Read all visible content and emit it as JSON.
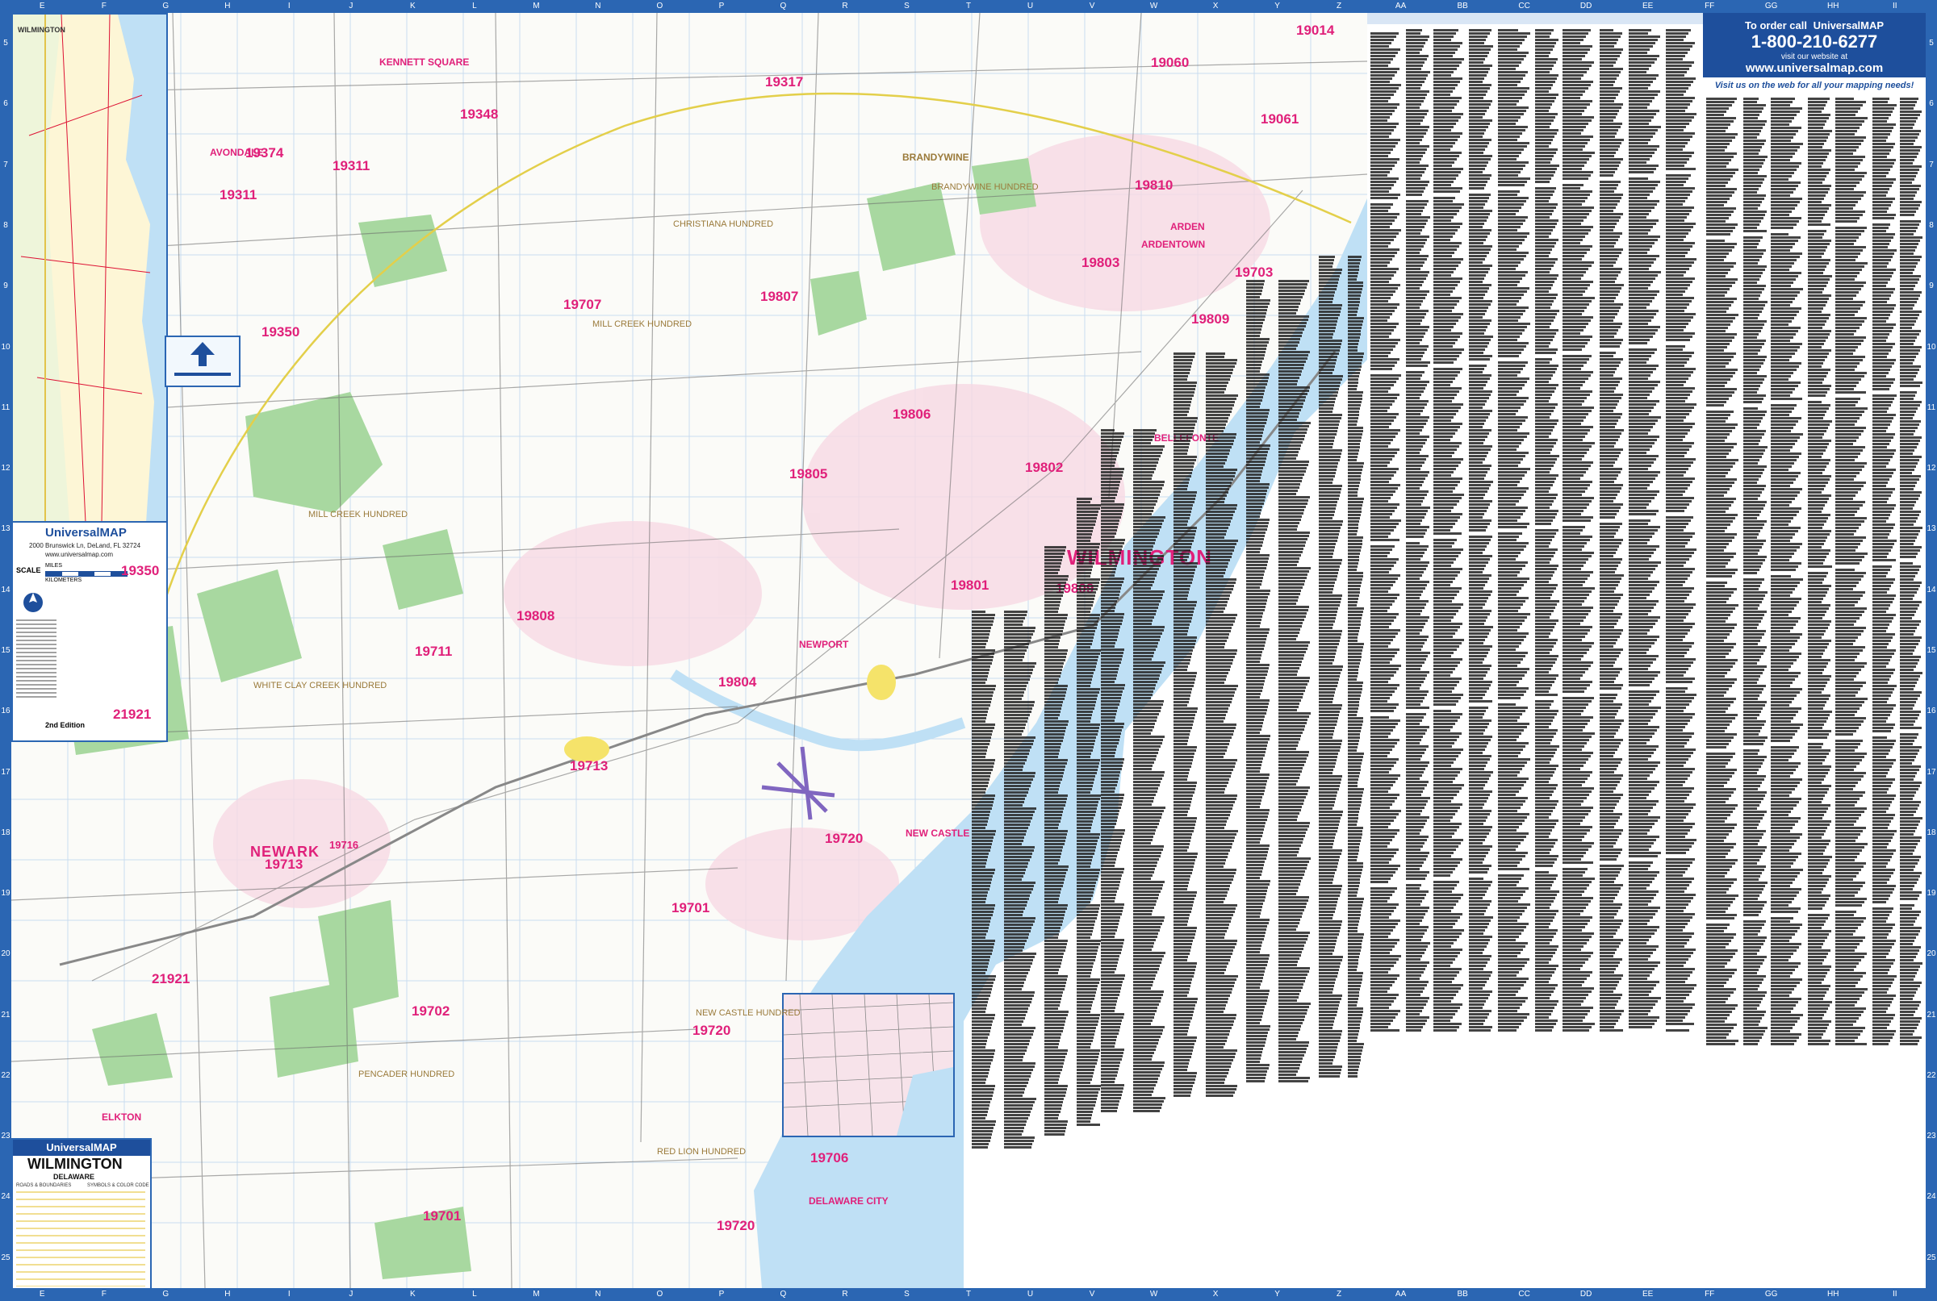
{
  "map": {
    "title": "WILMINGTON",
    "subtitle": "DELAWARE",
    "publisher": "UniversalMAP",
    "publisher_address": "2000 Brunswick Ln, DeLand, FL 32724",
    "publisher_url": "www.universalmap.com",
    "edition": "2nd Edition",
    "scale_label": "SCALE",
    "scale_miles": "MILES",
    "scale_km": "KILOMETERS",
    "scale_ticks": [
      "0",
      "0.5",
      "1.0"
    ],
    "legend_heading_left": "ROADS & BOUNDARIES",
    "legend_heading_right": "SYMBOLS & COLOR CODE"
  },
  "order": {
    "line1": "To order call",
    "brand": "UniversalMAP",
    "phone": "1-800-210-6277",
    "visit": "visit our website at",
    "url": "www.universalmap.com",
    "tagline": "Visit us on the web for all your mapping needs!"
  },
  "grid": {
    "columns": [
      "E",
      "F",
      "G",
      "H",
      "I",
      "J",
      "K",
      "L",
      "M",
      "N",
      "O",
      "P",
      "Q",
      "R",
      "S",
      "T",
      "U",
      "V",
      "W",
      "X",
      "Y",
      "Z",
      "AA",
      "BB",
      "CC",
      "DD",
      "EE",
      "FF",
      "GG",
      "HH",
      "II"
    ],
    "rows": [
      "5",
      "6",
      "7",
      "8",
      "9",
      "10",
      "11",
      "12",
      "13",
      "14",
      "15",
      "16",
      "17",
      "18",
      "19",
      "20",
      "21",
      "22",
      "23",
      "24",
      "25"
    ]
  },
  "labels": {
    "city_main": "WILMINGTON",
    "city_newark": "NEWARK",
    "zips": {
      "z19014": "19014",
      "z19060": "19060",
      "z19061": "19061",
      "z19317": "19317",
      "z19348": "19348",
      "z19374": "19374",
      "z19311a": "19311",
      "z19311b": "19311",
      "z19810": "19810",
      "z19803": "19803",
      "z19703": "19703",
      "z19809a": "19809",
      "z19707": "19707",
      "z19807": "19807",
      "z19350a": "19350",
      "z19806": "19806",
      "z19805": "19805",
      "z19802": "19802",
      "z19350b": "19350",
      "z19801": "19801",
      "z19809b": "19809",
      "z19808": "19808",
      "z19711": "19711",
      "z19804": "19804",
      "z21921a": "21921",
      "z19713a": "19713",
      "z19716": "19716",
      "z19713b": "19713",
      "z19720a": "19720",
      "z19701a": "19701",
      "z21921b": "21921",
      "z19702": "19702",
      "z19720b": "19720",
      "z19706": "19706",
      "z19701b": "19701",
      "z19720c": "19720"
    },
    "places": {
      "kennett": "KENNETT SQUARE",
      "avondale": "AVONDALE",
      "brandywine": "BRANDYWINE",
      "arden": "ARDEN",
      "ardentown": "ARDENTOWN",
      "bellefonte": "BELLEFONTE",
      "newport": "NEWPORT",
      "newcastle": "NEW CASTLE",
      "delawarecity": "DELAWARE CITY",
      "elkton": "ELKTON"
    },
    "hundreds": {
      "christiana": "CHRISTIANA HUNDRED",
      "millcreek1": "MILL CREEK HUNDRED",
      "millcreek2": "MILL CREEK HUNDRED",
      "whiteclay": "WHITE CLAY CREEK HUNDRED",
      "pencader": "PENCADER HUNDRED",
      "newcastle": "NEW CASTLE HUNDRED",
      "redlion": "RED LION HUNDRED",
      "brandywine": "BRANDYWINE HUNDRED"
    }
  },
  "colors": {
    "frame": "#2b66b3",
    "water": "#bfe0f5",
    "park": "#a8d8a0",
    "urban": "#f4c8d8",
    "zip": "#e0207a",
    "road": "#555555"
  }
}
